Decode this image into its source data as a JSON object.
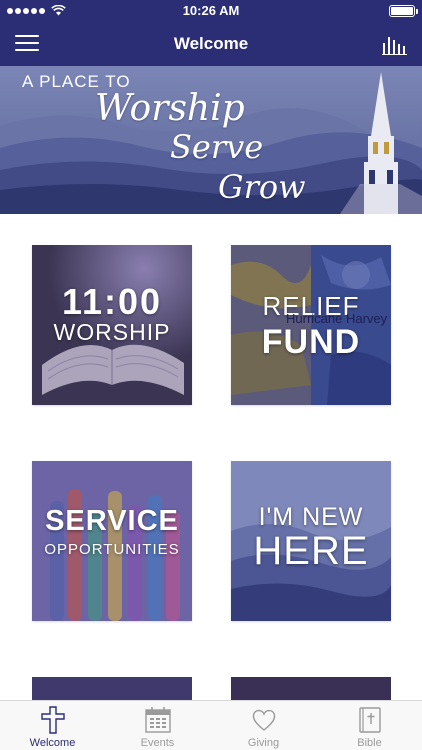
{
  "status_bar": {
    "time": "10:26 AM"
  },
  "nav": {
    "title": "Welcome"
  },
  "hero": {
    "line1": "A PLACE TO",
    "script_words": [
      "Worship",
      "Serve",
      "Grow"
    ]
  },
  "tiles": [
    {
      "id": "worship",
      "lines": [
        "11:00",
        "WORSHIP"
      ]
    },
    {
      "id": "relief",
      "lines": [
        "RELIEF",
        "FUND"
      ],
      "overlay_text": "Hurricane Harvey"
    },
    {
      "id": "service",
      "lines": [
        "SERVICE",
        "OPPORTUNITIES"
      ]
    },
    {
      "id": "new",
      "lines": [
        "I'M NEW",
        "HERE"
      ]
    }
  ],
  "tabs": [
    {
      "label": "Welcome",
      "icon": "cross-icon",
      "active": true
    },
    {
      "label": "Events",
      "icon": "calendar-icon",
      "active": false
    },
    {
      "label": "Giving",
      "icon": "heart-icon",
      "active": false
    },
    {
      "label": "Bible",
      "icon": "bible-icon",
      "active": false
    }
  ],
  "colors": {
    "brand": "#2b2d75",
    "tab_inactive": "#9a9a9a"
  }
}
